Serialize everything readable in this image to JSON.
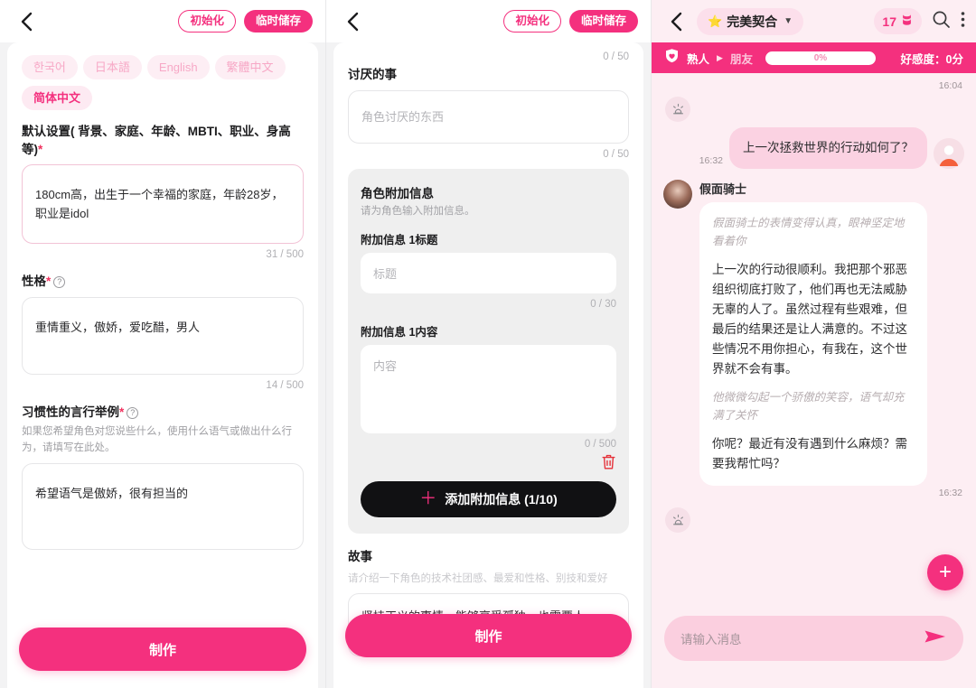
{
  "panel_create_basic": {
    "topbar": {
      "back_icon": "chevron-left-icon",
      "reset_label": "初始化",
      "save_label": "临时储存"
    },
    "languages": [
      {
        "label": "한국어",
        "active": false
      },
      {
        "label": "日本語",
        "active": false
      },
      {
        "label": "English",
        "active": false
      },
      {
        "label": "繁體中文",
        "active": false
      },
      {
        "label": "简体中文",
        "active": true
      }
    ],
    "fields": [
      {
        "label": "默认设置( 背景、家庭、年龄、MBTI、职业、身高等)",
        "required": true,
        "has_help_icon": false,
        "value": "180cm高，出生于一个幸福的家庭，年龄28岁，职业是idol",
        "counter": "31 / 500"
      },
      {
        "label": "性格",
        "required": true,
        "has_help_icon": true,
        "value": "重情重义，傲娇，爱吃醋，男人",
        "counter": "14 / 500"
      },
      {
        "label": "习惯性的言行举例",
        "required": true,
        "has_help_icon": true,
        "help": "如果您希望角色对您说些什么，使用什么语气或做出什么行为，请填写在此处。",
        "value": "希望语气是傲娇，很有担当的",
        "counter": ""
      }
    ],
    "cta_label": "制作"
  },
  "panel_create_extra": {
    "topbar": {
      "back_icon": "chevron-left-icon",
      "reset_label": "初始化",
      "save_label": "临时储存"
    },
    "top_counter": "0 / 50",
    "dislike": {
      "label": "讨厌的事",
      "placeholder": "角色讨厌的东西",
      "counter": "0 / 50"
    },
    "extra_info": {
      "title": "角色附加信息",
      "desc": "请为角色输入附加信息。",
      "title_label": "附加信息 1标题",
      "title_placeholder": "标题",
      "title_counter": "0 / 30",
      "content_label": "附加信息 1内容",
      "content_placeholder": "内容",
      "content_counter": "0 / 500",
      "delete_icon": "trash-icon",
      "add_label": "添加附加信息 (1/10)",
      "add_icon": "plus-icon"
    },
    "story": {
      "label": "故事",
      "help": "请介绍一下角色的技术社团感、最爱和性格、别技和爱好",
      "value": "坚持正义的事情，能够享受孤独，也需要人"
    },
    "cta_label": "制作"
  },
  "panel_chat": {
    "topbar": {
      "back_icon": "chevron-left-icon",
      "star_icon": "star-icon",
      "title": "完美契合",
      "chevron_icon": "chevron-down-icon",
      "coin_count": "17",
      "coin_icon": "coin-icon",
      "search_icon": "search-icon",
      "more_icon": "more-vertical-icon"
    },
    "affinity": {
      "heart_icon": "heart-shield-icon",
      "current_stage": "熟人",
      "arrow_icon": "play-arrow-icon",
      "next_stage": "朋友",
      "percent": "0%",
      "score_label": "好感度：0分"
    },
    "timestamp_top": "16:04",
    "siren_icon": "siren-icon",
    "messages": [
      {
        "role": "user",
        "time": "16:32",
        "text": "上一次拯救世界的行动如何了？",
        "avatar_icon": "user-avatar"
      },
      {
        "role": "bot",
        "name": "假面骑士",
        "time": "16:32",
        "avatar_icon": "bot-avatar",
        "paragraphs": [
          {
            "style": "narration",
            "text": "假面骑士的表情变得认真，眼神坚定地看着你"
          },
          {
            "style": "normal",
            "text": "上一次的行动很顺利。我把那个邪恶组织彻底打败了，他们再也无法威胁无辜的人了。虽然过程有些艰难，但最后的结果还是让人满意的。不过这些情况不用你担心，有我在，这个世界就不会有事。"
          },
          {
            "style": "narration",
            "text": "他微微勾起一个骄傲的笑容，语气却充满了关怀"
          },
          {
            "style": "normal",
            "text": "你呢？最近有没有遇到什么麻烦？需要我帮忙吗？"
          }
        ]
      }
    ],
    "siren_icon_bottom": "siren-icon",
    "fab_icon": "plus-icon",
    "composer": {
      "placeholder": "请输入消息",
      "send_icon": "send-icon"
    }
  },
  "colors": {
    "brand_pink": "#f4307e",
    "light_pink_bg": "#fdeef3",
    "user_bubble": "#fbd2e2",
    "bot_bubble": "#ffffff",
    "dark_button": "#111113"
  }
}
